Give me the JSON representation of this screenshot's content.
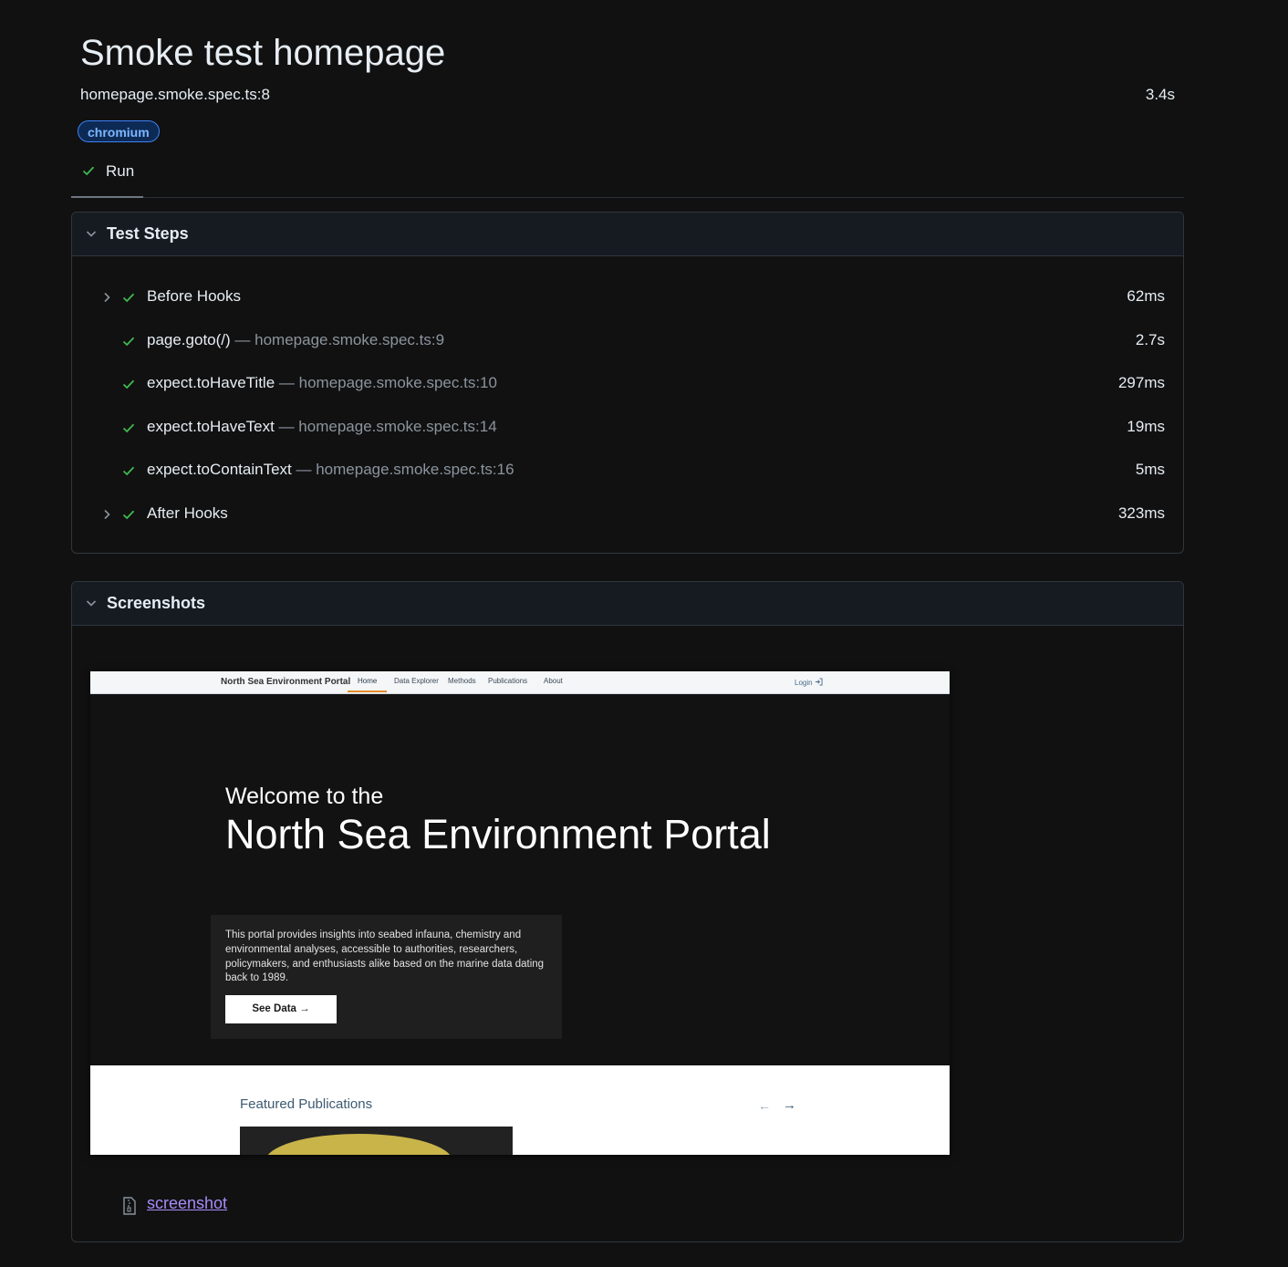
{
  "header": {
    "title": "Smoke test homepage",
    "spec": "homepage.smoke.spec.ts:8",
    "duration": "3.4s",
    "project_badge": "chromium"
  },
  "tabs": [
    {
      "label": "Run",
      "status": "passed"
    }
  ],
  "test_steps": {
    "title": "Test Steps",
    "steps": [
      {
        "name": "Before Hooks",
        "location": "",
        "duration": "62ms",
        "expandable": true
      },
      {
        "name": "page.goto(/)",
        "location": " — homepage.smoke.spec.ts:9",
        "duration": "2.7s",
        "expandable": false
      },
      {
        "name": "expect.toHaveTitle",
        "location": " — homepage.smoke.spec.ts:10",
        "duration": "297ms",
        "expandable": false
      },
      {
        "name": "expect.toHaveText",
        "location": " — homepage.smoke.spec.ts:14",
        "duration": "19ms",
        "expandable": false
      },
      {
        "name": "expect.toContainText",
        "location": " — homepage.smoke.spec.ts:16",
        "duration": "5ms",
        "expandable": false
      },
      {
        "name": "After Hooks",
        "location": "",
        "duration": "323ms",
        "expandable": true
      }
    ]
  },
  "screenshots": {
    "title": "Screenshots",
    "attachment_link": "screenshot",
    "page": {
      "nav": {
        "brand": "North Sea Environment Portal",
        "items": [
          "Home",
          "Data Explorer",
          "Methods",
          "Publications",
          "About"
        ],
        "login": "Login"
      },
      "hero_line1": "Welcome to the",
      "hero_line2": "North Sea Environment Portal",
      "description": "This portal provides insights into seabed infauna, chemistry and environmental analyses, accessible to authorities, researchers, policymakers, and enthusiasts alike based on the marine data dating back to 1989.",
      "cta": "See Data →",
      "featured_title": "Featured Publications",
      "arrow_prev": "←",
      "arrow_next": "→"
    }
  },
  "colors": {
    "background": "#111111",
    "panel_header": "#161b22",
    "pass_green": "#3fb950",
    "badge_blue": "#3b82f6",
    "link_purple": "#a78bfa",
    "nav_accent": "#e38b2c"
  },
  "icons": {
    "pass": "check-icon",
    "collapse": "chevron-down-icon",
    "expand": "chevron-right-icon",
    "attachment": "file-zip-icon",
    "login": "login-icon"
  }
}
